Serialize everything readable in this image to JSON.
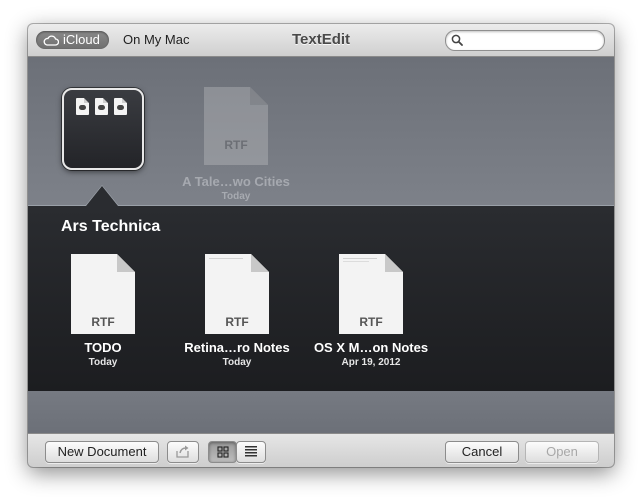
{
  "window": {
    "title": "TextEdit"
  },
  "toolbar": {
    "icloud_label": "iCloud",
    "on_my_mac_label": "On My Mac",
    "search": {
      "placeholder": "",
      "value": ""
    }
  },
  "upper": {
    "ghost_document": {
      "type": "RTF",
      "name": "A Tale…wo Cities",
      "date": "Today"
    }
  },
  "folder": {
    "name": "Ars Technica",
    "documents": [
      {
        "type": "RTF",
        "name": "TODO",
        "date": "Today"
      },
      {
        "type": "RTF",
        "name": "Retina…ro Notes",
        "date": "Today"
      },
      {
        "type": "RTF",
        "name": "OS X M…on Notes",
        "date": "Apr 19, 2012"
      }
    ]
  },
  "bottombar": {
    "new_document_label": "New Document",
    "cancel_label": "Cancel",
    "open_label": "Open"
  }
}
